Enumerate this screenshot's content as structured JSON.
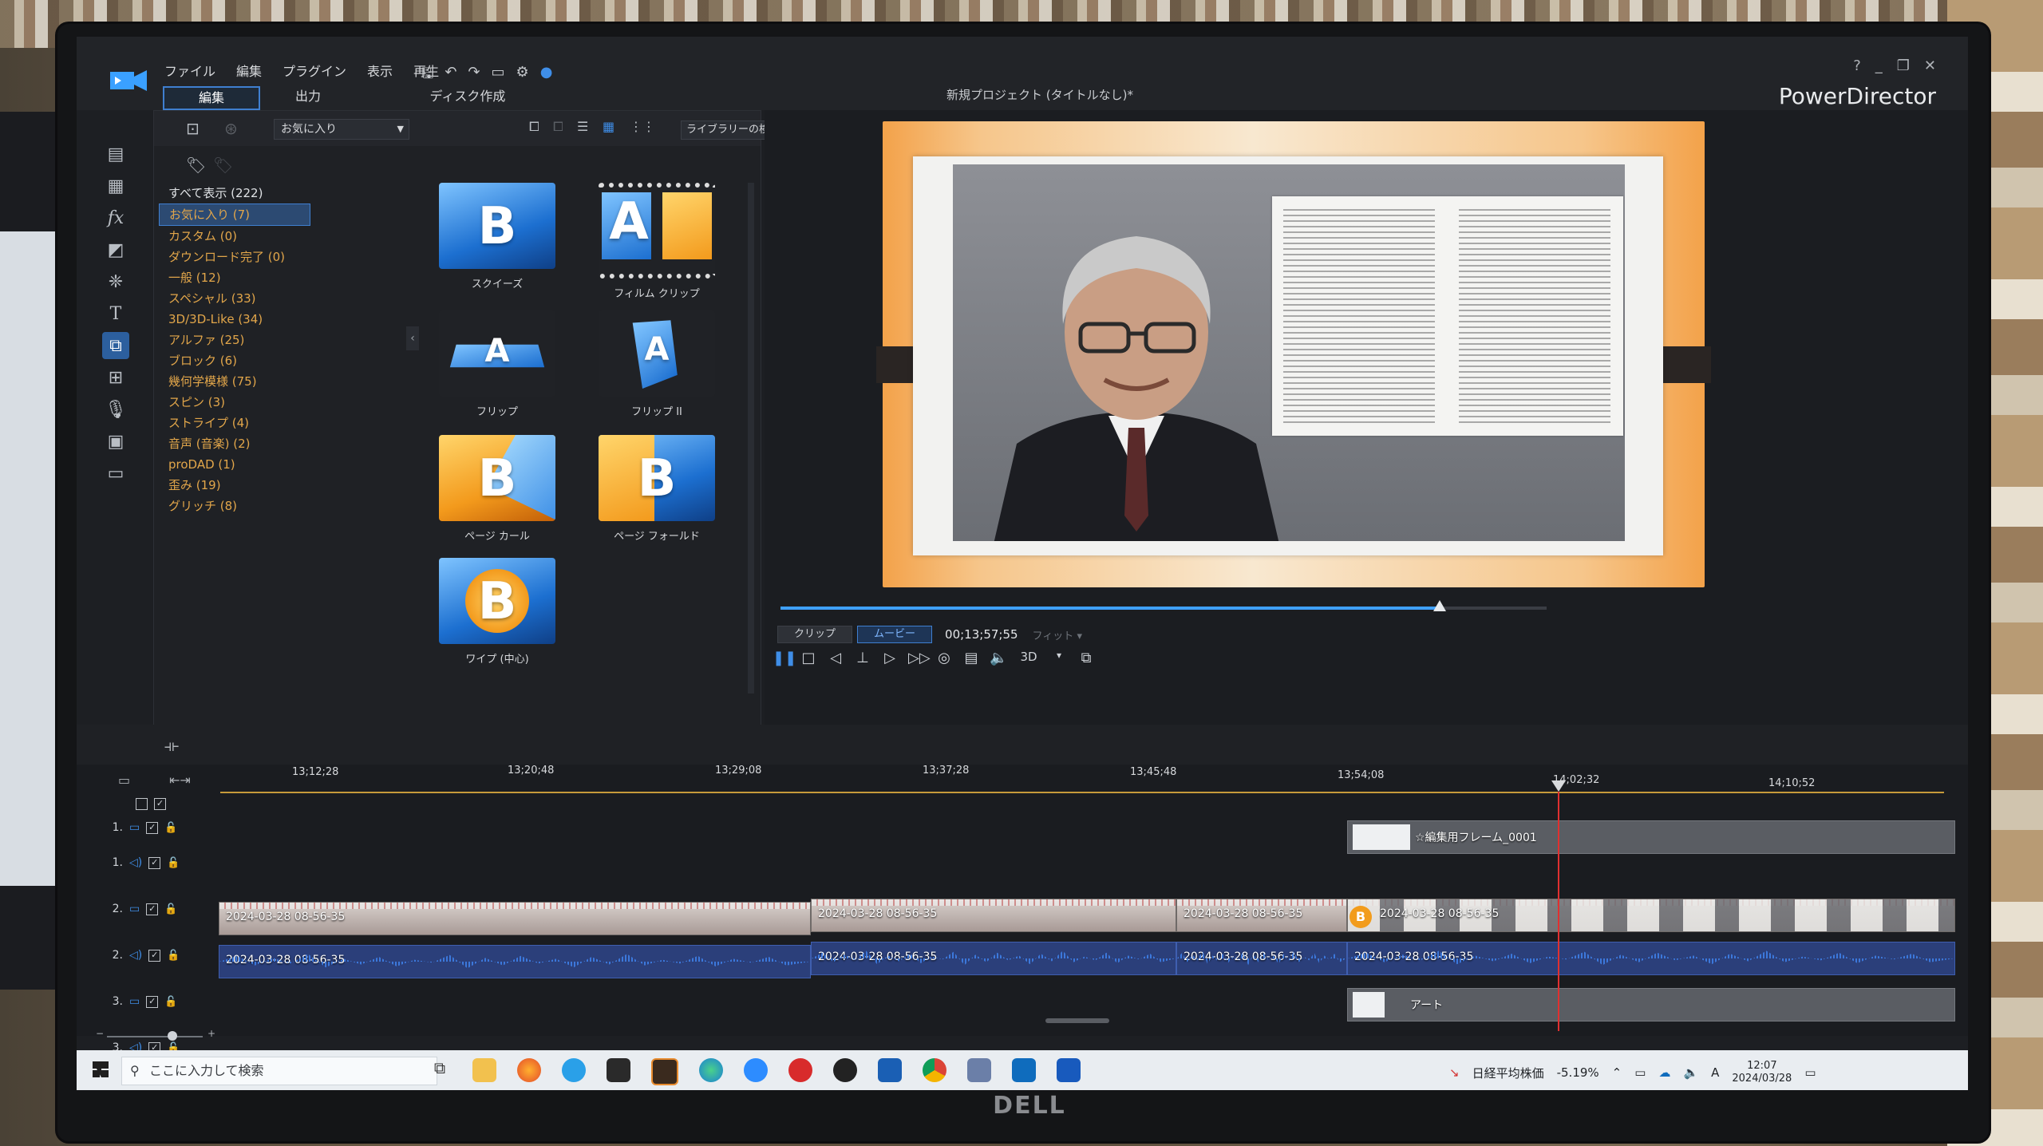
{
  "app": {
    "brand": "PowerDirector",
    "title": "新規プロジェクト (タイトルなし)*",
    "menu": [
      "ファイル",
      "編集",
      "プラグイン",
      "表示",
      "再生"
    ],
    "tabs": [
      "編集",
      "出力",
      "ディスク作成"
    ],
    "active_tab": "編集"
  },
  "library": {
    "dropdown": "お気に入り",
    "search_placeholder": "ライブラリーの検索",
    "categories": [
      {
        "label": "すべて表示 (222)",
        "kind": "all"
      },
      {
        "label": "お気に入り (7)",
        "kind": "selected"
      },
      {
        "label": "カスタム (0)"
      },
      {
        "label": "ダウンロード完了 (0)"
      },
      {
        "label": "一般 (12)"
      },
      {
        "label": "スペシャル (33)"
      },
      {
        "label": "3D/3D-Like (34)"
      },
      {
        "label": "アルファ (25)"
      },
      {
        "label": "ブロック (6)"
      },
      {
        "label": "幾何学模様 (75)"
      },
      {
        "label": "スピン (3)"
      },
      {
        "label": "ストライプ (4)"
      },
      {
        "label": "音声 (音楽) (2)"
      },
      {
        "label": "proDAD (1)"
      },
      {
        "label": "歪み (19)"
      },
      {
        "label": "グリッチ (8)"
      }
    ],
    "effects": [
      {
        "label": "スクイーズ",
        "style": "blue",
        "glyph": "B"
      },
      {
        "label": "フィルム クリップ",
        "style": "dark",
        "glyph": "A"
      },
      {
        "label": "フリップ",
        "style": "dark",
        "glyph": "A"
      },
      {
        "label": "フリップ II",
        "style": "dark",
        "glyph": "A"
      },
      {
        "label": "ページ カール",
        "style": "orange",
        "glyph": "B"
      },
      {
        "label": "ページ フォールド",
        "style": "blue",
        "glyph": "B"
      },
      {
        "label": "ワイプ (中心)",
        "style": "blue",
        "glyph": "B"
      }
    ]
  },
  "preview": {
    "mode_clip": "クリップ",
    "mode_movie": "ムービー",
    "timecode": "00;13;57;55",
    "fit": "フィット",
    "threed": "3D",
    "progress": 0.86
  },
  "timeline": {
    "ticks": [
      "13;12;28",
      "13;20;48",
      "13;29;08",
      "13;37;28",
      "13;45;48",
      "13;54;08",
      "14;02;32",
      "14;10;52"
    ],
    "tracks": [
      {
        "num": "1.",
        "type": "video"
      },
      {
        "num": "1.",
        "type": "audio"
      },
      {
        "num": "2.",
        "type": "video"
      },
      {
        "num": "2.",
        "type": "audio"
      },
      {
        "num": "3.",
        "type": "video"
      },
      {
        "num": "3.",
        "type": "audio"
      }
    ],
    "clip_frame": "☆編集用フレーム_0001",
    "clip_v1": "2024-03-28 08-56-35",
    "clip_v2": "2024-03-28 08-56-35",
    "clip_v3": "2024-03-28 08-56-35",
    "clip_v4": "2024-03-28 08-56-35",
    "clip_a1": "2024-03-28 08-56-35",
    "clip_a2": "2024-03-28 08-56-35",
    "clip_a3": "2024-03-28 08-56-35",
    "clip_a4": "2024-03-28 08-56-35",
    "clip_art": "アート"
  },
  "taskbar": {
    "search_placeholder": "ここに入力して検索",
    "stock_label": "日経平均株価",
    "stock_change": "-5.19%",
    "time": "12:07",
    "date": "2024/03/28",
    "ime": "A"
  },
  "monitor": {
    "brand": "DELL"
  },
  "colors": {
    "accent": "#3f7fd0",
    "category_text": "#e2a64a",
    "playhead": "#e03030"
  }
}
